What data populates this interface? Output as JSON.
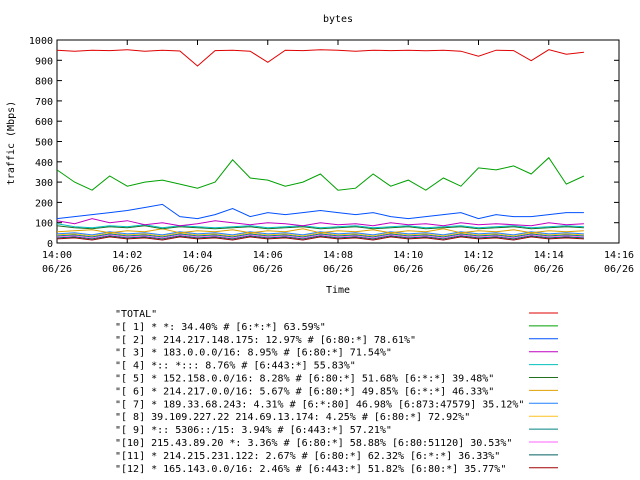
{
  "chart_data": {
    "type": "line",
    "title": "bytes",
    "xlabel": "Time",
    "ylabel": "traffic (Mbps)",
    "ylim": [
      0,
      1000
    ],
    "yticks": [
      "0",
      "100",
      "200",
      "300",
      "400",
      "500",
      "600",
      "700",
      "800",
      "900",
      "1000"
    ],
    "xlim": [
      "14:00 06/26",
      "14:16 06/26"
    ],
    "xticks": [
      {
        "time": "14:00",
        "date": "06/26"
      },
      {
        "time": "14:02",
        "date": "06/26"
      },
      {
        "time": "14:04",
        "date": "06/26"
      },
      {
        "time": "14:06",
        "date": "06/26"
      },
      {
        "time": "14:08",
        "date": "06/26"
      },
      {
        "time": "14:10",
        "date": "06/26"
      },
      {
        "time": "14:12",
        "date": "06/26"
      },
      {
        "time": "14:14",
        "date": "06/26"
      },
      {
        "time": "14:16",
        "date": "06/26"
      }
    ],
    "grid": false,
    "legend_position": "bottom",
    "x_minutes": [
      0,
      0.5,
      1,
      1.5,
      2,
      2.5,
      3,
      3.5,
      4,
      4.5,
      5,
      5.5,
      6,
      6.5,
      7,
      7.5,
      8,
      8.5,
      9,
      9.5,
      10,
      10.5,
      11,
      11.5,
      12,
      12.5,
      13,
      13.5,
      14,
      14.5,
      15
    ],
    "series": [
      {
        "name": "\"TOTAL\"",
        "color": "#e00000",
        "values": [
          950,
          945,
          950,
          948,
          952,
          945,
          950,
          946,
          872,
          948,
          950,
          945,
          890,
          950,
          948,
          952,
          950,
          945,
          950,
          948,
          950,
          947,
          950,
          945,
          920,
          950,
          948,
          898,
          952,
          930,
          940
        ]
      },
      {
        "name": "\"[ 1] * *: 34.40% # [6:*:*] 63.59%\"",
        "color": "#00a000",
        "values": [
          360,
          300,
          260,
          330,
          280,
          300,
          310,
          290,
          270,
          300,
          410,
          320,
          310,
          280,
          300,
          340,
          260,
          270,
          340,
          280,
          310,
          260,
          320,
          280,
          370,
          360,
          380,
          340,
          420,
          290,
          330
        ]
      },
      {
        "name": "\"[ 2] * 214.217.148.175: 12.97% # [6:80:*] 78.61%\"",
        "color": "#0050ff",
        "values": [
          120,
          130,
          140,
          150,
          160,
          175,
          190,
          130,
          120,
          140,
          170,
          130,
          150,
          140,
          150,
          160,
          150,
          140,
          150,
          130,
          120,
          130,
          140,
          150,
          120,
          140,
          130,
          130,
          140,
          150,
          150
        ]
      },
      {
        "name": "\"[ 3] * 183.0.0.0/16: 8.95% # [6:80:*] 71.54%\"",
        "color": "#c000c0",
        "values": [
          110,
          95,
          120,
          100,
          110,
          90,
          100,
          85,
          95,
          110,
          100,
          90,
          100,
          95,
          85,
          100,
          90,
          95,
          85,
          100,
          90,
          95,
          85,
          100,
          90,
          95,
          90,
          85,
          100,
          90,
          95
        ]
      },
      {
        "name": "\"[ 4] *:: *::: 8.76% # [6:443:*] 55.83%\"",
        "color": "#00c0c0",
        "values": [
          95,
          80,
          75,
          85,
          80,
          90,
          75,
          85,
          80,
          75,
          80,
          85,
          75,
          80,
          85,
          75,
          80,
          85,
          75,
          80,
          85,
          75,
          80,
          85,
          75,
          80,
          85,
          75,
          80,
          85,
          80
        ]
      },
      {
        "name": "\"[ 5] * 152.158.0.0/16: 8.28% # [6:80:*] 51.68% [6:*:*] 39.48%\"",
        "color": "#207020",
        "values": [
          85,
          75,
          70,
          80,
          75,
          85,
          70,
          80,
          75,
          70,
          75,
          80,
          70,
          75,
          80,
          70,
          75,
          80,
          70,
          75,
          80,
          70,
          75,
          80,
          70,
          75,
          80,
          70,
          75,
          80,
          75
        ]
      },
      {
        "name": "\"[ 6] * 214.217.0.0/16: 5.67% # [6:80:*] 49.85% [6:*:*] 46.33%\"",
        "color": "#e0a000",
        "values": [
          55,
          60,
          65,
          50,
          60,
          55,
          70,
          50,
          60,
          55,
          65,
          50,
          60,
          55,
          70,
          50,
          60,
          55,
          65,
          50,
          60,
          55,
          70,
          50,
          60,
          55,
          65,
          50,
          60,
          55,
          60
        ]
      },
      {
        "name": "\"[ 7] * 189.33.68.243: 4.31% # [6:*:80] 46.98% [6:873:47579] 35.12%\"",
        "color": "#2080ff",
        "values": [
          45,
          50,
          40,
          55,
          45,
          50,
          40,
          55,
          45,
          50,
          40,
          55,
          45,
          50,
          40,
          55,
          45,
          50,
          40,
          55,
          45,
          50,
          40,
          55,
          45,
          50,
          40,
          55,
          45,
          50,
          45
        ]
      },
      {
        "name": "\"[ 8] 39.109.227.22 214.69.13.174: 4.25% # [6:80:*] 72.92%\"",
        "color": "#ffc020",
        "values": [
          40,
          45,
          35,
          50,
          40,
          45,
          35,
          50,
          40,
          45,
          35,
          50,
          40,
          45,
          35,
          50,
          40,
          45,
          35,
          50,
          40,
          45,
          35,
          50,
          40,
          45,
          35,
          50,
          40,
          45,
          40
        ]
      },
      {
        "name": "\"[ 9] *:: 5306::/15: 3.94% # [6:443:*] 57.21%\"",
        "color": "#008080",
        "values": [
          35,
          40,
          30,
          45,
          35,
          40,
          30,
          45,
          35,
          40,
          30,
          45,
          35,
          40,
          30,
          45,
          35,
          40,
          30,
          45,
          35,
          40,
          30,
          45,
          35,
          40,
          30,
          45,
          35,
          40,
          35
        ]
      },
      {
        "name": "\"[10] 215.43.89.20 *: 3.36% # [6:80:*] 58.88% [6:80:51120] 30.53%\"",
        "color": "#ff60ff",
        "values": [
          30,
          35,
          25,
          40,
          30,
          35,
          25,
          40,
          30,
          35,
          25,
          40,
          30,
          35,
          25,
          40,
          30,
          35,
          25,
          40,
          30,
          35,
          25,
          40,
          30,
          35,
          25,
          40,
          30,
          35,
          30
        ]
      },
      {
        "name": "\"[11] * 214.215.231.122: 2.67% # [6:80:*] 62.32% [6:*:*] 36.33%\"",
        "color": "#006060",
        "values": [
          25,
          30,
          20,
          35,
          25,
          30,
          20,
          35,
          25,
          30,
          20,
          35,
          25,
          30,
          20,
          35,
          25,
          30,
          20,
          35,
          25,
          30,
          20,
          35,
          25,
          30,
          20,
          35,
          25,
          30,
          25
        ]
      },
      {
        "name": "\"[12] * 165.143.0.0/16: 2.46% # [6:443:*] 51.82% [6:80:*] 35.77%\"",
        "color": "#a00000",
        "values": [
          20,
          25,
          15,
          30,
          20,
          25,
          15,
          30,
          20,
          25,
          15,
          30,
          20,
          25,
          15,
          30,
          20,
          25,
          15,
          30,
          20,
          25,
          15,
          30,
          20,
          25,
          15,
          30,
          20,
          25,
          20
        ]
      }
    ]
  }
}
